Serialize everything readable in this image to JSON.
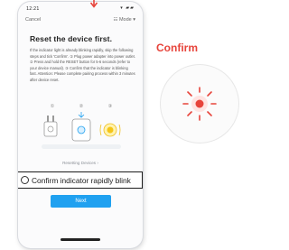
{
  "status_bar": {
    "time": "12:21",
    "icons": "▾ ▰▰"
  },
  "top_bar": {
    "cancel_label": "Cancel",
    "mode_label": "☷ Mode ▾"
  },
  "page": {
    "title": "Reset the device first.",
    "instructions": "If the indicator light is already blinking rapidly, skip the following steps and tick 'Confirm'. ① Plug power adapter into power outlet. ② Press and hold the RESET button for 5-6 seconds (refer to your device manual). ③ Confirm that the indicator is blinking fast. Attention: Please complete pairing process within 3 minutes after device reset.",
    "illustration_labels": [
      "①",
      "②",
      "③"
    ],
    "link_text": "Resetting Devices ›",
    "confirm_label": "Confirm indicator rapidly blink",
    "next_label": "Next"
  },
  "callout": {
    "title": "Confirm"
  },
  "colors": {
    "accent": "#20a1f0",
    "alert": "#e7443b"
  }
}
